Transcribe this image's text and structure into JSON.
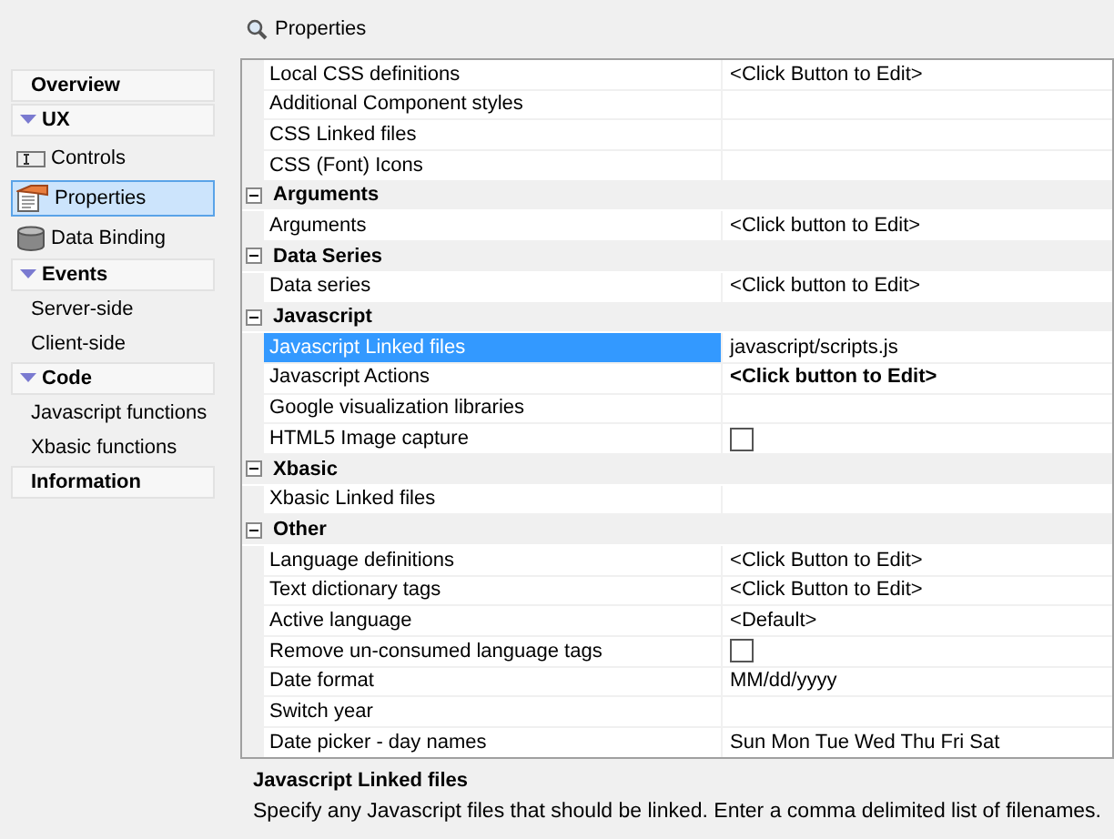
{
  "header": {
    "title": "Properties"
  },
  "sidebar": {
    "items": [
      {
        "kind": "header",
        "label": "Overview",
        "selected": false
      },
      {
        "kind": "section",
        "label": "UX",
        "expanded": true,
        "selected": false
      },
      {
        "kind": "item",
        "label": "Controls",
        "selected": false
      },
      {
        "kind": "item",
        "label": "Properties",
        "selected": true
      },
      {
        "kind": "item",
        "label": "Data Binding",
        "selected": false
      },
      {
        "kind": "section",
        "label": "Events",
        "expanded": true,
        "selected": false
      },
      {
        "kind": "subitem",
        "label": "Server-side",
        "selected": false
      },
      {
        "kind": "subitem",
        "label": "Client-side",
        "selected": false
      },
      {
        "kind": "section",
        "label": "Code",
        "expanded": true,
        "selected": false
      },
      {
        "kind": "subitem",
        "label": "Javascript functions",
        "selected": false
      },
      {
        "kind": "subitem",
        "label": "Xbasic functions",
        "selected": false
      },
      {
        "kind": "header",
        "label": "Information",
        "selected": false
      }
    ]
  },
  "grid": {
    "rows": [
      {
        "kind": "property",
        "name": "Local CSS definitions",
        "value": "<Click Button to Edit>",
        "selected": false
      },
      {
        "kind": "property",
        "name": "Additional Component styles",
        "selected": false
      },
      {
        "kind": "property",
        "name": "CSS Linked files",
        "selected": false
      },
      {
        "kind": "property",
        "name": "CSS (Font) Icons",
        "selected": false
      },
      {
        "kind": "category",
        "name": "Arguments",
        "expanded": true
      },
      {
        "kind": "property",
        "name": "Arguments",
        "value": "<Click button to Edit>",
        "selected": false
      },
      {
        "kind": "category",
        "name": "Data Series",
        "expanded": true
      },
      {
        "kind": "property",
        "name": "Data series",
        "value": "<Click button to Edit>",
        "selected": false
      },
      {
        "kind": "category",
        "name": "Javascript",
        "expanded": true
      },
      {
        "kind": "property",
        "name": "Javascript Linked files",
        "value": "javascript/scripts.js",
        "selected": true
      },
      {
        "kind": "property",
        "name": "Javascript Actions",
        "value": "<Click button to Edit>",
        "bold": true,
        "selected": false
      },
      {
        "kind": "property",
        "name": "Google visualization libraries",
        "selected": false
      },
      {
        "kind": "property",
        "name": "HTML5 Image capture",
        "checkbox": {
          "checked": false
        },
        "selected": false
      },
      {
        "kind": "category",
        "name": "Xbasic",
        "expanded": true
      },
      {
        "kind": "property",
        "name": "Xbasic Linked files",
        "selected": false
      },
      {
        "kind": "category",
        "name": "Other",
        "expanded": true
      },
      {
        "kind": "property",
        "name": "Language definitions",
        "value": "<Click Button to Edit>",
        "selected": false
      },
      {
        "kind": "property",
        "name": "Text dictionary tags",
        "value": "<Click Button to Edit>",
        "selected": false
      },
      {
        "kind": "property",
        "name": "Active language",
        "value": "<Default>",
        "selected": false
      },
      {
        "kind": "property",
        "name": "Remove un-consumed language tags",
        "checkbox": {
          "checked": false
        },
        "selected": false
      },
      {
        "kind": "property",
        "name": "Date format",
        "value": "MM/dd/yyyy",
        "selected": false
      },
      {
        "kind": "property",
        "name": "Switch year",
        "selected": false
      },
      {
        "kind": "property",
        "name": "Date picker - day names",
        "value": "Sun Mon Tue Wed Thu Fri Sat",
        "selected": false
      }
    ]
  },
  "description": {
    "title": "Javascript Linked files",
    "text": "Specify any Javascript files that should be linked. Enter a comma delimited list of filenames."
  }
}
